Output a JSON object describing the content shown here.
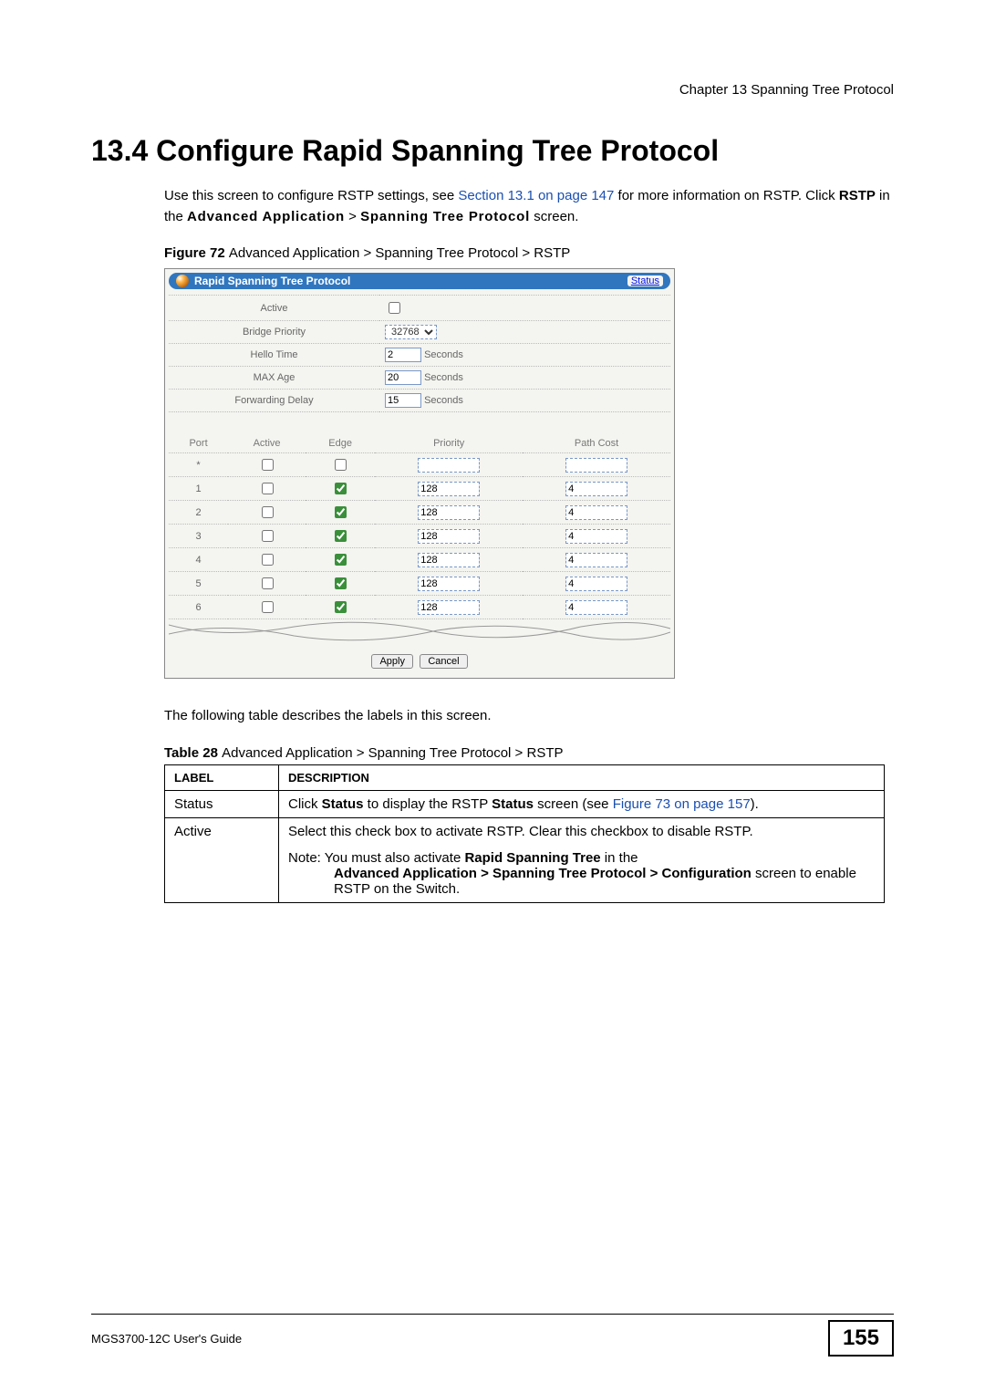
{
  "chapter_header": "Chapter 13 Spanning Tree Protocol",
  "h1_prefix": "13.4  ",
  "h1_title": "Configure Rapid Spanning Tree Protocol",
  "intro": {
    "p1_a": "Use this screen to configure RSTP settings, see ",
    "p1_link": "Section 13.1 on page 147",
    "p1_b": " for more information on RSTP. Click ",
    "p1_rstp": "RSTP",
    "p1_c": " in the ",
    "p1_adv": "Advanced Application",
    "p1_d": " > ",
    "p1_stp": "Spanning Tree Protocol",
    "p1_e": " screen."
  },
  "figure_caption": {
    "bold": "Figure 72   ",
    "rest": "Advanced Application > Spanning Tree Protocol > RSTP"
  },
  "panel": {
    "title": "Rapid Spanning Tree Protocol",
    "status_link": "Status",
    "rows": {
      "active": "Active",
      "bridge_priority": "Bridge Priority",
      "bridge_priority_value": "32768",
      "hello_time": "Hello Time",
      "hello_time_value": "2",
      "max_age": "MAX Age",
      "max_age_value": "20",
      "forwarding_delay": "Forwarding Delay",
      "forwarding_delay_value": "15",
      "seconds": "Seconds"
    },
    "port_headers": {
      "port": "Port",
      "active": "Active",
      "edge": "Edge",
      "priority": "Priority",
      "path_cost": "Path Cost"
    },
    "ports": [
      {
        "port": "*",
        "priority": "",
        "cost": ""
      },
      {
        "port": "1",
        "priority": "128",
        "cost": "4"
      },
      {
        "port": "2",
        "priority": "128",
        "cost": "4"
      },
      {
        "port": "3",
        "priority": "128",
        "cost": "4"
      },
      {
        "port": "4",
        "priority": "128",
        "cost": "4"
      },
      {
        "port": "5",
        "priority": "128",
        "cost": "4"
      },
      {
        "port": "6",
        "priority": "128",
        "cost": "4"
      }
    ],
    "apply": "Apply",
    "cancel": "Cancel"
  },
  "after_figure": "The following table describes the labels in this screen.",
  "table_caption": {
    "bold": "Table 28   ",
    "rest": "Advanced Application > Spanning Tree Protocol > RSTP"
  },
  "desc_table": {
    "th_label": "LABEL",
    "th_desc": "DESCRIPTION",
    "rows": [
      {
        "label": "Status",
        "d1a": "Click ",
        "d1b": "Status",
        "d1c": " to display the RSTP ",
        "d1d": "Status",
        "d1e": " screen (see ",
        "d1link": "Figure 73 on page 157",
        "d1f": ")."
      },
      {
        "label": "Active",
        "d2a": "Select this check box to activate RSTP. Clear this checkbox to disable RSTP.",
        "note_lead": "Note: You must also activate ",
        "note_b1": "Rapid Spanning Tree",
        "note_mid1": " in the ",
        "note_b2": "Advanced Application > Spanning Tree Protocol > Configuration",
        "note_mid2": " screen to enable RSTP on the Switch."
      }
    ]
  },
  "footer": {
    "guide": "MGS3700-12C User's Guide",
    "page": "155"
  }
}
